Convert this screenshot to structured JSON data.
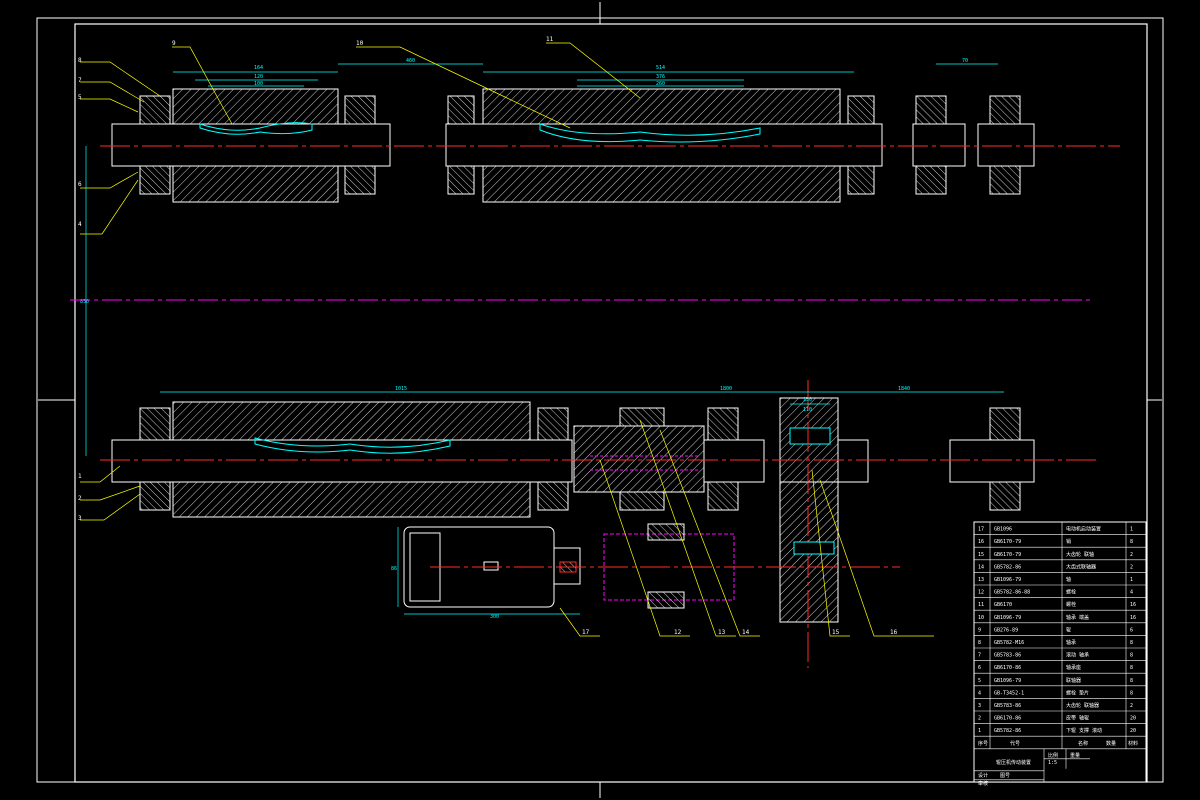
{
  "colors": {
    "background": "#000000",
    "frame": "#ffffff",
    "centerline": "#ff2a2a",
    "dimension": "#00ffff",
    "leader": "#ffff00",
    "phantom": "#ff00ff",
    "hatch": "#ffffff"
  },
  "title_block": {
    "rows": [
      {
        "no": "17",
        "code": "GB1096",
        "name": "电动机启动装置",
        "qty": "1",
        "material": ""
      },
      {
        "no": "16",
        "code": "GB6170-79",
        "name": "销",
        "qty": "8",
        "material": "45钢"
      },
      {
        "no": "15",
        "code": "GB6170-79",
        "name": "大齿轮 联轴",
        "qty": "2",
        "material": "Q235"
      },
      {
        "no": "14",
        "code": "GB5782-86",
        "name": "大齿式联轴器",
        "qty": "2",
        "material": "HT200"
      },
      {
        "no": "13",
        "code": "GB1096-79",
        "name": "轴",
        "qty": "1",
        "material": "45钢"
      },
      {
        "no": "12",
        "code": "GB5782-86-88",
        "name": "螺栓",
        "qty": "4",
        "material": "45钢"
      },
      {
        "no": "11",
        "code": "GB6170",
        "name": "螺栓",
        "qty": "16",
        "material": "45钢"
      },
      {
        "no": "10",
        "code": "GB1096-79",
        "name": "轴承 端盖",
        "qty": "16",
        "material": "HT150"
      },
      {
        "no": "9",
        "code": "GB276-89",
        "name": "辊",
        "qty": "6",
        "material": "45钢"
      },
      {
        "no": "8",
        "code": "GB5782-M16",
        "name": "轴承",
        "qty": "8",
        "material": "45钢"
      },
      {
        "no": "7",
        "code": "GB5783-86",
        "name": "滚动 轴承",
        "qty": "8",
        "material": "HT200"
      },
      {
        "no": "6",
        "code": "GB6170-86",
        "name": "轴承座",
        "qty": "8",
        "material": "Q235"
      },
      {
        "no": "5",
        "code": "GB1096-79",
        "name": "联轴器",
        "qty": "8",
        "material": "HT200"
      },
      {
        "no": "4",
        "code": "GB-T3452-1",
        "name": "螺栓 垫片",
        "qty": "8",
        "material": "HT200"
      },
      {
        "no": "3",
        "code": "GB5783-86",
        "name": "大齿轮 联轴器",
        "qty": "2",
        "material": "45钢"
      },
      {
        "no": "2",
        "code": "GB6170-86",
        "name": "皮带 轴辊",
        "qty": "20",
        "material": "HT150"
      },
      {
        "no": "1",
        "code": "GB5782-86",
        "name": "下辊 支撑 滚动",
        "qty": "20",
        "material": "45钢"
      }
    ],
    "header": {
      "no": "序号",
      "code": "代号",
      "name": "名称",
      "qty": "数量",
      "material": "材料"
    },
    "title": "辊压机传动装置",
    "scale_label": "比例",
    "scale": "1:5",
    "sheet_label": "图号",
    "designer_label": "设计",
    "checker_label": "审核",
    "weight_label": "重量",
    "qty_label": "件数"
  },
  "dimensions": {
    "d1": "164",
    "d2": "120",
    "d3": "100",
    "d4": "460",
    "d5": "514",
    "d6": "376",
    "d7": "260",
    "d8": "1015",
    "d9": "1800",
    "d10": "1840",
    "d11": "130",
    "d12": "110",
    "d13": "160",
    "d14": "120",
    "d15": "180",
    "d16": "850",
    "d17": "300",
    "d18": "86",
    "d19": "70"
  },
  "labels": {
    "p1": "1",
    "p2": "2",
    "p3": "3",
    "p4": "4",
    "p5": "5",
    "p6": "6",
    "p7": "7",
    "p8": "8",
    "p9": "9",
    "p10": "10",
    "p11": "11",
    "p12": "12",
    "p13": "13",
    "p14": "14",
    "p15": "15",
    "p16": "16",
    "p17": "17"
  }
}
